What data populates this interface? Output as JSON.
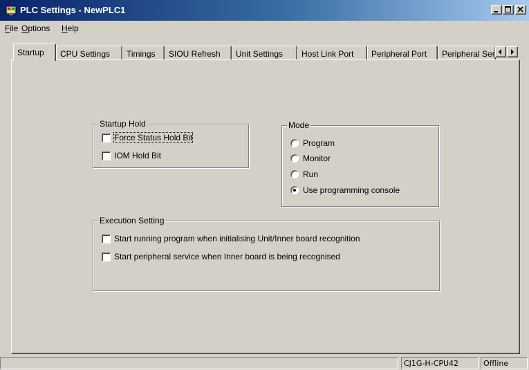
{
  "window": {
    "title": "PLC Settings - NewPLC1",
    "icon": "plc-settings-icon",
    "controls": [
      "minimize",
      "maximize",
      "close"
    ]
  },
  "menu": {
    "items": [
      {
        "label": "File",
        "mnemonic": "F",
        "rest": "ile"
      },
      {
        "label": "Options",
        "mnemonic": "O",
        "rest": "ptions"
      },
      {
        "label": "Help",
        "mnemonic": "H",
        "rest": "elp"
      }
    ]
  },
  "tabs": {
    "active": "Startup",
    "items": [
      {
        "label": "Startup"
      },
      {
        "label": "CPU Settings"
      },
      {
        "label": "Timings"
      },
      {
        "label": "SIOU Refresh"
      },
      {
        "label": "Unit Settings"
      },
      {
        "label": "Host Link Port"
      },
      {
        "label": "Peripheral Port"
      },
      {
        "label": "Peripheral Service"
      }
    ]
  },
  "startup_hold": {
    "title": "Startup Hold",
    "options": [
      {
        "label": "Force Status Hold Bit",
        "checked": false
      },
      {
        "label": "IOM Hold Bit",
        "checked": false
      }
    ]
  },
  "mode": {
    "title": "Mode",
    "options": [
      {
        "label": "Program",
        "selected": false
      },
      {
        "label": "Monitor",
        "selected": false
      },
      {
        "label": "Run",
        "selected": false
      },
      {
        "label": "Use programming console",
        "selected": true
      }
    ]
  },
  "execution": {
    "title": "Execution Setting",
    "options": [
      {
        "label": "Start running program when initialising Unit/Inner board recognition",
        "checked": false
      },
      {
        "label": "Start peripheral service when Inner board is being recognised",
        "checked": false
      }
    ]
  },
  "status": {
    "device": "CJ1G-H-CPU42",
    "connection": "Offline"
  }
}
